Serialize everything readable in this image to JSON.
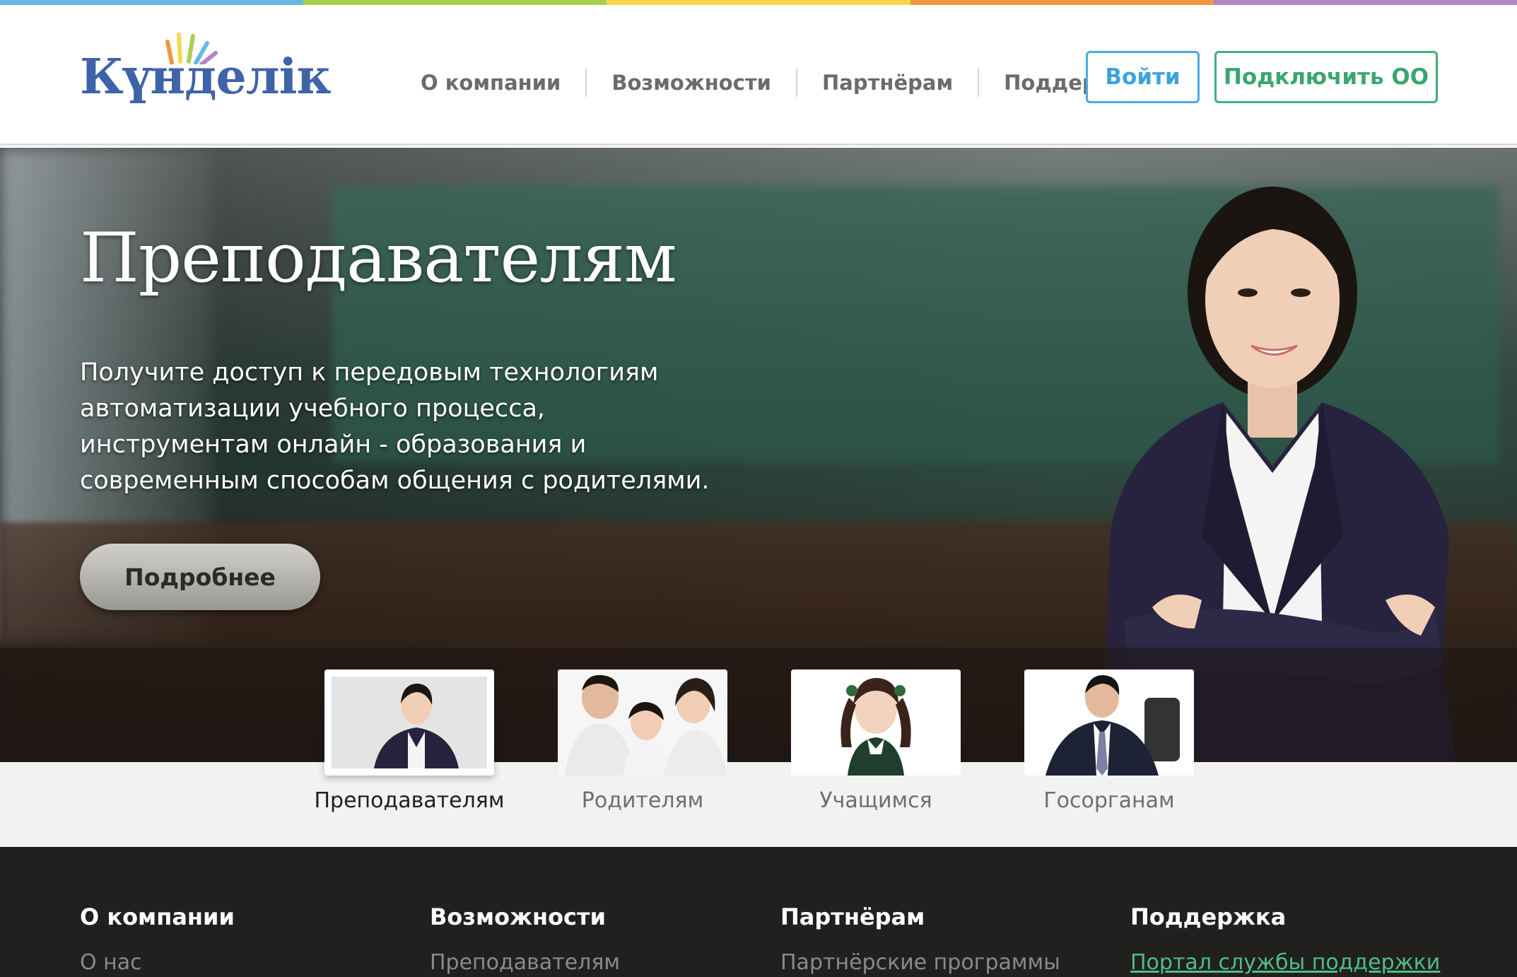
{
  "colors": {
    "stripe": [
      "#66b9e1",
      "#a9cf52",
      "#f5d64d",
      "#f0963e",
      "#b584c3"
    ],
    "login_border": "#4aace0",
    "connect_border": "#41b07b",
    "logo_blue": "#3f63a8",
    "footer_bg": "#221f1f",
    "support_link": "#4bbf85"
  },
  "header": {
    "logo": "Күнделік",
    "nav": [
      "О компании",
      "Возможности",
      "Партнёрам",
      "Поддержка"
    ],
    "login_label": "Войти",
    "connect_label": "Подключить ОО"
  },
  "hero": {
    "title": "Преподавателям",
    "description": "Получите доступ к передовым технологиям автоматизации учебного процесса, инструментам онлайн - образования и современным способам общения с родителями.",
    "more_label": "Подробнее"
  },
  "audiences": [
    {
      "label": "Преподавателям",
      "active": true
    },
    {
      "label": "Родителям",
      "active": false
    },
    {
      "label": "Учащимся",
      "active": false
    },
    {
      "label": "Госорганам",
      "active": false
    }
  ],
  "footer": {
    "columns": [
      {
        "heading": "О компании",
        "first_link": "О нас"
      },
      {
        "heading": "Возможности",
        "first_link": "Преподавателям"
      },
      {
        "heading": "Партнёрам",
        "first_link": "Партнёрские программы"
      },
      {
        "heading": "Поддержка",
        "first_link": "Портал службы поддержки"
      }
    ]
  }
}
